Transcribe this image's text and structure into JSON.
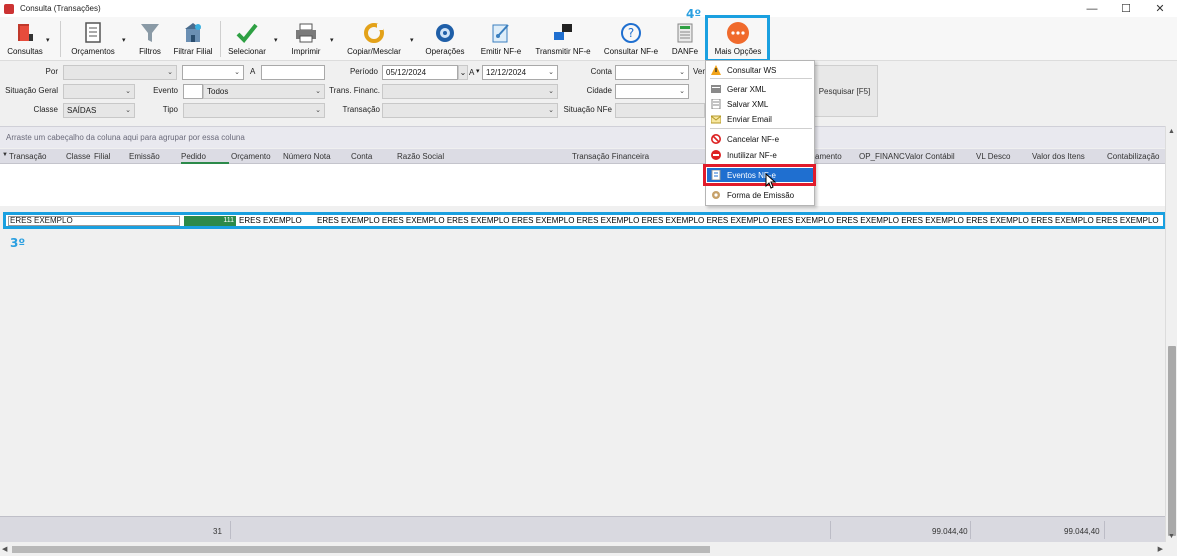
{
  "window": {
    "title": "Consulta (Transações)",
    "minimize": "—",
    "maximize": "☐",
    "close": "✕"
  },
  "toolbar": {
    "items": [
      {
        "label": "Consultas",
        "icon": "book-icon"
      },
      {
        "label": "Orçamentos",
        "icon": "document-icon"
      },
      {
        "label": "Filtros",
        "icon": "funnel-icon"
      },
      {
        "label": "Filtrar Filial",
        "icon": "building-icon"
      },
      {
        "label": "Selecionar",
        "icon": "checkmark-icon"
      },
      {
        "label": "Imprimir",
        "icon": "printer-icon"
      },
      {
        "label": "Copiar/Mesclar",
        "icon": "copy-icon"
      },
      {
        "label": "Operações",
        "icon": "gear-icon"
      },
      {
        "label": "Emitir NF-e",
        "icon": "emit-icon"
      },
      {
        "label": "Transmitir NF-e",
        "icon": "transmit-icon"
      },
      {
        "label": "Consultar NF-e",
        "icon": "help-icon"
      },
      {
        "label": "DANFe",
        "icon": "danfe-icon"
      },
      {
        "label": "Mais Opções",
        "icon": "more-icon"
      }
    ]
  },
  "annotations": {
    "step4": "4º",
    "step3": "3º"
  },
  "filters": {
    "por_label": "Por",
    "a_label": "A",
    "periodo_label": "Período",
    "periodo_from": "05/12/2024",
    "periodo_a_label": "A",
    "periodo_to": "12/12/2024",
    "conta_label": "Conta",
    "ven_label": "Ven",
    "situacao_geral_label": "Situação Geral",
    "evento_label": "Evento",
    "evento_value": "Todos",
    "trans_financ_label": "Trans. Financ.",
    "cidade_label": "Cidade",
    "classe_label": "Classe",
    "classe_value": "SAÍDAS",
    "tipo_label": "Tipo",
    "transacao_label": "Transação",
    "situacao_nfe_label": "Situação NFe",
    "search_button": "Pesquisar [F5]"
  },
  "grid": {
    "group_hint": "Arraste um cabeçalho da coluna aqui para agrupar por essa coluna",
    "columns": [
      "Transação",
      "Classe",
      "Filial",
      "Emissão",
      "Pedido",
      "Orçamento",
      "Número Nota",
      "Conta",
      "Razão Social",
      "Transação Financeira",
      "amento",
      "OP_FINANC",
      "Valor Contábil",
      "VL Desco",
      "Valor dos Itens",
      "Contabilização"
    ],
    "row": {
      "first": "ERES EXEMPLO",
      "pedido": "111",
      "razao": "ERES EXEMPLO",
      "rest": "ERES EXEMPLO  ERES EXEMPLO  ERES EXEMPLO ERES EXEMPLO ERES EXEMPLO ERES EXEMPLO ERES EXEMPLO ERES EXEMPLO ERES EXEMPLO ERES EXEMPLO ERES EXEMPLO ERES EXEMPLO ERES EXEMPLO"
    },
    "footer": {
      "count": "31",
      "valor_contabil": "99.044,40",
      "valor_itens": "99.044,40"
    }
  },
  "menu": {
    "items": [
      {
        "label": "Consultar WS",
        "icon": "warning-icon"
      },
      {
        "label": "Gerar XML",
        "icon": "xml-icon"
      },
      {
        "label": "Salvar XML",
        "icon": "save-xml-icon"
      },
      {
        "label": "Enviar Email",
        "icon": "email-icon"
      },
      {
        "label": "Cancelar NF-e",
        "icon": "cancel-icon"
      },
      {
        "label": "Inutilizar NF-e",
        "icon": "block-icon"
      },
      {
        "label": "Eventos NF-e",
        "icon": "events-icon"
      },
      {
        "label": "Forma de Emissão",
        "icon": "form-icon"
      }
    ]
  },
  "colors": {
    "accent_blue": "#1aa0e0",
    "highlight_red": "#e01b2b",
    "menu_selected": "#1f6fd0",
    "pedido_green": "#2c8a4a"
  }
}
